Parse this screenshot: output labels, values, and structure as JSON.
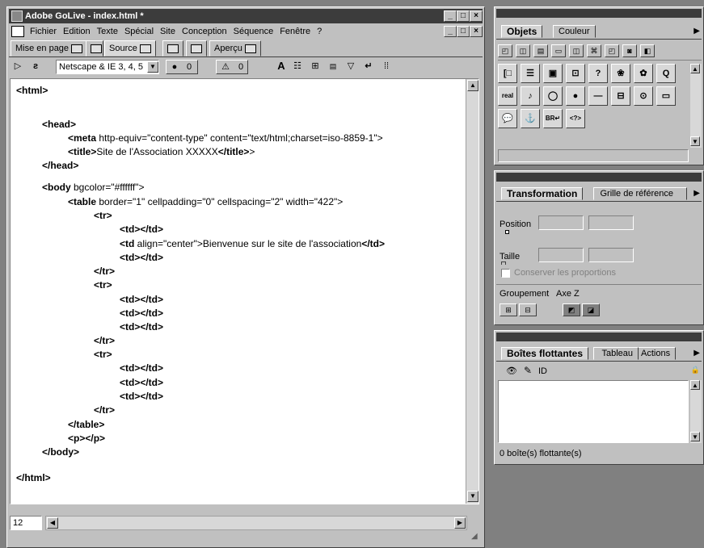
{
  "main_window": {
    "title": "Adobe GoLive - index.html *",
    "controls": {
      "minimize": "_",
      "maximize": "□",
      "close": "×"
    },
    "menu": [
      "Fichier",
      "Edition",
      "Texte",
      "Spécial",
      "Site",
      "Conception",
      "Séquence",
      "Fenêtre",
      "?"
    ],
    "tabs": [
      "Mise en page",
      "Source",
      "Aperçu"
    ],
    "toolbar": {
      "browser_select": "Netscape & IE 3, 4, 5",
      "errors_count": "0",
      "warnings_count": "0"
    },
    "code": [
      {
        "indent": 0,
        "parts": [
          [
            "t",
            "<html>"
          ]
        ]
      },
      {
        "indent": 2,
        "parts": [
          [
            "t",
            "<head>"
          ]
        ]
      },
      {
        "indent": 4,
        "parts": [
          [
            "t",
            "<meta"
          ],
          [
            "a",
            " http-equiv=\"content-type\" content=\"text/html;charset=iso-8859-1\">"
          ]
        ]
      },
      {
        "indent": 4,
        "parts": [
          [
            "t",
            "<title>"
          ],
          [
            "a",
            "Site de l'Association XXXXX"
          ],
          [
            "t",
            "</title>"
          ],
          [
            "a",
            ">"
          ]
        ]
      },
      {
        "indent": 2,
        "parts": [
          [
            "t",
            "</head>"
          ]
        ]
      },
      {
        "indent": 2,
        "parts": [
          [
            "t",
            "<body"
          ],
          [
            "a",
            " bgcolor=\"#ffffff\">"
          ]
        ]
      },
      {
        "indent": 4,
        "parts": [
          [
            "t",
            "<table"
          ],
          [
            "a",
            " border=\"1\" cellpadding=\"0\" cellspacing=\"2\" width=\"422\">"
          ]
        ]
      },
      {
        "indent": 6,
        "parts": [
          [
            "t",
            "<tr>"
          ]
        ]
      },
      {
        "indent": 8,
        "parts": [
          [
            "t",
            "<td></td>"
          ]
        ]
      },
      {
        "indent": 8,
        "parts": [
          [
            "t",
            "<td"
          ],
          [
            "a",
            " align=\"center\">Bienvenue sur le site de l'association"
          ],
          [
            "t",
            "</td>"
          ]
        ]
      },
      {
        "indent": 8,
        "parts": [
          [
            "t",
            "<td></td>"
          ]
        ]
      },
      {
        "indent": 6,
        "parts": [
          [
            "t",
            "</tr>"
          ]
        ]
      },
      {
        "indent": 6,
        "parts": [
          [
            "t",
            "<tr>"
          ]
        ]
      },
      {
        "indent": 8,
        "parts": [
          [
            "t",
            "<td></td>"
          ]
        ]
      },
      {
        "indent": 8,
        "parts": [
          [
            "t",
            "<td></td>"
          ]
        ]
      },
      {
        "indent": 8,
        "parts": [
          [
            "t",
            "<td></td>"
          ]
        ]
      },
      {
        "indent": 6,
        "parts": [
          [
            "t",
            "</tr>"
          ]
        ]
      },
      {
        "indent": 6,
        "parts": [
          [
            "t",
            "<tr>"
          ]
        ]
      },
      {
        "indent": 8,
        "parts": [
          [
            "t",
            "<td></td>"
          ]
        ]
      },
      {
        "indent": 8,
        "parts": [
          [
            "t",
            "<td></td>"
          ]
        ]
      },
      {
        "indent": 8,
        "parts": [
          [
            "t",
            "<td></td>"
          ]
        ]
      },
      {
        "indent": 6,
        "parts": [
          [
            "t",
            "</tr>"
          ]
        ]
      },
      {
        "indent": 4,
        "parts": [
          [
            "t",
            "</table>"
          ]
        ]
      },
      {
        "indent": 4,
        "parts": [
          [
            "t",
            "<p></p>"
          ]
        ]
      },
      {
        "indent": 2,
        "parts": [
          [
            "t",
            "</body>"
          ]
        ]
      },
      {
        "indent": 0,
        "parts": [
          [
            "t",
            "</html>"
          ]
        ]
      }
    ],
    "status_line_number": "12"
  },
  "objects_palette": {
    "tabs": [
      "Objets",
      "Couleur"
    ],
    "icons_row2": [
      "[□",
      "☰",
      "▣",
      "⊡",
      "?",
      "❀",
      "✿",
      "Q"
    ],
    "icons_row3": [
      "real",
      "♪",
      "◯",
      "●",
      "—",
      "⊟",
      "⊙",
      "▭"
    ],
    "icons_row4": [
      "💬",
      "⚓",
      "BR↵",
      "<?>"
    ]
  },
  "transform_palette": {
    "tabs": [
      "Transformation",
      "Grille de référence"
    ],
    "position_label": "Position",
    "size_label": "Taille",
    "keep_proportions_label": "Conserver les proportions",
    "group_label": "Groupement",
    "zaxis_label": "Axe Z"
  },
  "floating_palette": {
    "tabs": [
      "Boîtes flottantes",
      "Tableau",
      "Actions"
    ],
    "id_column": "ID",
    "count_text": "0 boîte(s) flottante(s)"
  }
}
